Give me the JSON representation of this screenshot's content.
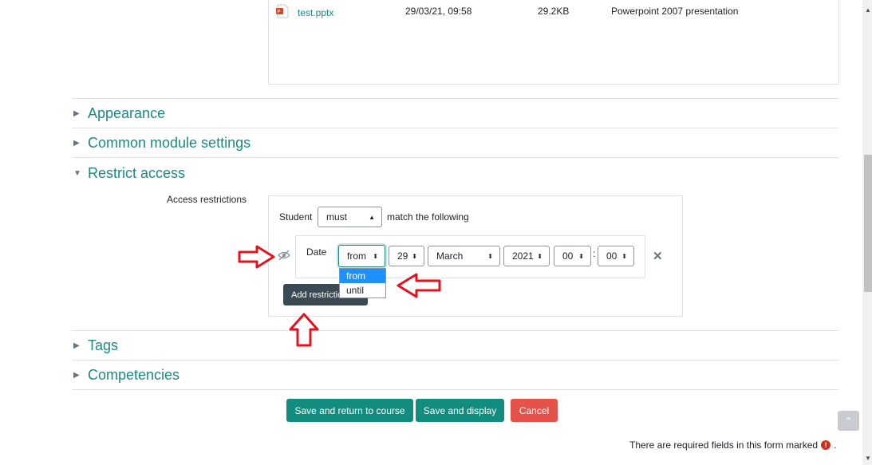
{
  "file": {
    "name": "test.pptx",
    "date": "29/03/21, 09:58",
    "size": "29.2KB",
    "type": "Powerpoint 2007 presentation"
  },
  "sections": {
    "appearance": "Appearance",
    "common": "Common module settings",
    "restrict": "Restrict access",
    "tags": "Tags",
    "competencies": "Competencies"
  },
  "restrict": {
    "label": "Access restrictions",
    "student_label": "Student",
    "must_value": "must",
    "match_label": "match the following",
    "date_label": "Date",
    "from_value": "from",
    "day_value": "29",
    "month_value": "March",
    "year_value": "2021",
    "hour_value": "00",
    "minute_value": "00",
    "colon": ":",
    "add_button": "Add restriction...",
    "dropdown_options": [
      "from",
      "until"
    ]
  },
  "buttons": {
    "save_return": "Save and return to course",
    "save_display": "Save and display",
    "cancel": "Cancel"
  },
  "required_note": "There are required fields in this form marked",
  "required_note_end": ".",
  "colors": {
    "accent": "#1a8a80",
    "button": "#128c7e",
    "cancel": "#e4524a",
    "annotation": "#e0141e"
  }
}
